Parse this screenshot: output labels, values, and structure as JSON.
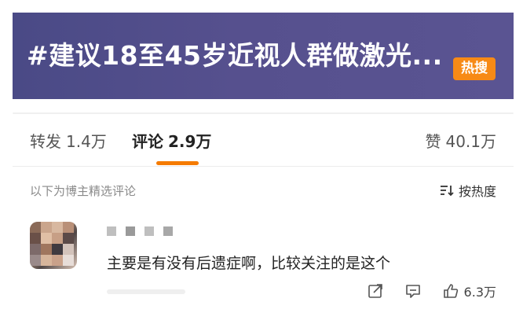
{
  "banner": {
    "title": "#建议18至45岁近视人群做激光...",
    "badge": "热搜",
    "badge_color": "#f78a16"
  },
  "tabs": {
    "repost": {
      "label": "转发",
      "count": "1.4万"
    },
    "comments": {
      "label": "评论",
      "count": "2.9万"
    },
    "likes": {
      "label": "赞",
      "count": "40.1万"
    },
    "active": "comments",
    "accent": "#f57b00"
  },
  "subheader": {
    "label": "以下为博主精选评论",
    "sort": "按热度",
    "sort_icon": "sort-list-icon"
  },
  "comment": {
    "text": "主要是有没有后遗症啊，比较关注的是这个",
    "like_count": "6.3万",
    "icons": [
      "share-icon",
      "reply-icon",
      "thumbs-up-icon"
    ]
  }
}
